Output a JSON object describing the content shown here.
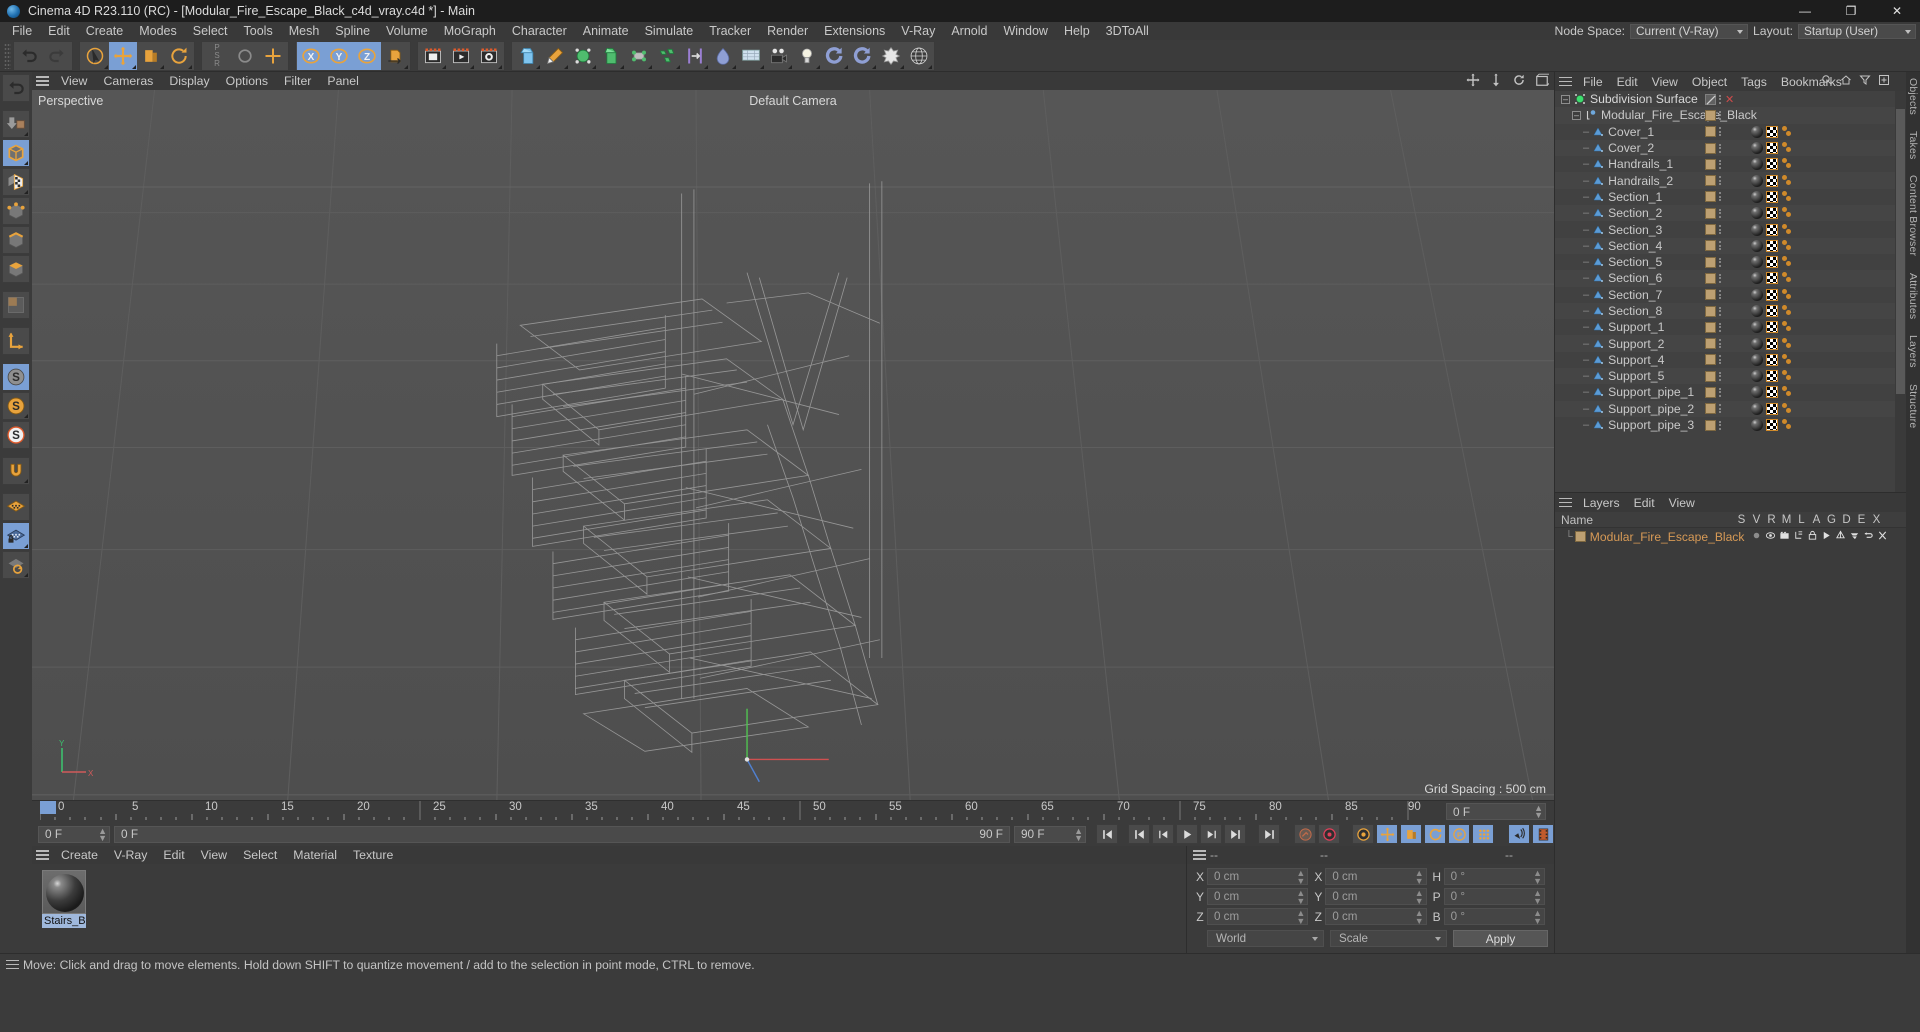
{
  "window": {
    "title": "Cinema 4D R23.110 (RC) - [Modular_Fire_Escape_Black_c4d_vray.c4d *] - Main",
    "app_icon": "c4d-logo-icon",
    "minimize": "—",
    "maximize": "❐",
    "close": "✕"
  },
  "menubar": {
    "items": [
      "File",
      "Edit",
      "Create",
      "Modes",
      "Select",
      "Tools",
      "Mesh",
      "Spline",
      "Volume",
      "MoGraph",
      "Character",
      "Animate",
      "Simulate",
      "Tracker",
      "Render",
      "Extensions",
      "V-Ray",
      "Arnold",
      "Window",
      "Help",
      "3DToAll"
    ],
    "node_space_label": "Node Space:",
    "node_space_value": "Current (V-Ray)",
    "layout_label": "Layout:",
    "layout_value": "Startup (User)"
  },
  "toolbar": {
    "groups": [
      {
        "name": "undo-redo",
        "buttons": [
          {
            "name": "undo-button",
            "icon": "undo-arrow-icon",
            "active": false
          },
          {
            "name": "redo-button",
            "icon": "redo-arrow-icon",
            "active": false
          }
        ]
      },
      {
        "name": "transform-tools",
        "buttons": [
          {
            "name": "select-tool",
            "icon": "cursor-arrow-icon",
            "active": false
          },
          {
            "name": "move-tool",
            "icon": "move-cross-icon",
            "active": true
          },
          {
            "name": "scale-tool",
            "icon": "scale-box-icon",
            "active": false
          },
          {
            "name": "rotate-tool",
            "icon": "rotate-circle-icon",
            "active": false
          }
        ]
      },
      {
        "name": "psr-group",
        "buttons": [
          {
            "name": "psr-label",
            "icon": "psr-text-icon",
            "active": false
          },
          {
            "name": "world-coordinates-toggle",
            "icon": "axis-cross-icon",
            "active": false
          }
        ]
      },
      {
        "name": "axis-locks",
        "buttons": [
          {
            "name": "lock-x-axis",
            "icon": "x-axis-icon",
            "active": true
          },
          {
            "name": "lock-y-axis",
            "icon": "y-axis-icon",
            "active": true
          },
          {
            "name": "lock-z-axis",
            "icon": "z-axis-icon",
            "active": true
          },
          {
            "name": "object-world-toggle",
            "icon": "world-cube-icon",
            "active": false
          }
        ]
      },
      {
        "name": "render-group",
        "buttons": [
          {
            "name": "render-view-button",
            "icon": "render-frame-icon",
            "active": false
          },
          {
            "name": "render-to-picture-viewer-button",
            "icon": "render-play-icon",
            "active": false
          },
          {
            "name": "render-settings-button",
            "icon": "render-gear-icon",
            "active": false
          }
        ]
      },
      {
        "name": "create-group",
        "buttons": [
          {
            "name": "add-primitive-cube-button",
            "icon": "cube-primitive-icon",
            "active": false
          },
          {
            "name": "add-spline-pen-button",
            "icon": "pen-spline-icon",
            "active": false
          },
          {
            "name": "add-generator-button",
            "icon": "generator-icon",
            "active": false
          },
          {
            "name": "add-nurbs-button",
            "icon": "nurbs-icon",
            "active": false
          },
          {
            "name": "add-deformer-button",
            "icon": "deformer-icon",
            "active": false
          },
          {
            "name": "add-mograph-button",
            "icon": "mograph-icon",
            "active": false
          },
          {
            "name": "add-field-button",
            "icon": "field-icon",
            "active": false
          },
          {
            "name": "add-dynamics-button",
            "icon": "dynamics-icon",
            "active": false
          },
          {
            "name": "add-floor-button",
            "icon": "floor-grid-icon",
            "active": false
          },
          {
            "name": "add-camera-button",
            "icon": "camera-icon",
            "active": false
          },
          {
            "name": "add-light-button",
            "icon": "light-bulb-icon",
            "active": false
          },
          {
            "name": "add-subdivision-button",
            "icon": "subdivision-icon",
            "active": false
          },
          {
            "name": "add-symmetry-button",
            "icon": "symmetry-icon",
            "active": false
          },
          {
            "name": "add-cloth-button",
            "icon": "cloth-icon",
            "active": false
          },
          {
            "name": "add-sky-button",
            "icon": "sky-globe-icon",
            "active": false
          }
        ]
      }
    ]
  },
  "left_rail": [
    {
      "name": "undo-rail-button",
      "icon": "undo-arrow-icon",
      "active": false
    },
    {
      "name": "make-editable-button",
      "icon": "make-editable-icon",
      "active": false
    },
    {
      "name": "model-mode-button",
      "icon": "model-cube-icon",
      "active": true
    },
    {
      "name": "texture-mode-button",
      "icon": "texture-checker-icon",
      "active": false
    },
    {
      "name": "point-mode-button",
      "icon": "point-mode-icon",
      "active": false
    },
    {
      "name": "edge-mode-button",
      "icon": "edge-mode-icon",
      "active": false
    },
    {
      "name": "polygon-mode-button",
      "icon": "polygon-mode-icon",
      "active": false
    },
    {
      "name": "uv-mode-button",
      "icon": "uv-mode-icon",
      "active": false
    },
    {
      "name": "axis-mode-button",
      "icon": "axis-L-icon",
      "active": false
    },
    {
      "name": "enable-axis-button",
      "icon": "s-grey-icon",
      "active": true
    },
    {
      "name": "enable-deformers-button",
      "icon": "s-orange-icon",
      "active": false
    },
    {
      "name": "viewport-solo-button",
      "icon": "s-white-icon",
      "active": false
    },
    {
      "name": "snap-magnet-button",
      "icon": "magnet-icon",
      "active": false
    },
    {
      "name": "workplane-button",
      "icon": "workplane-orange-icon",
      "active": false
    },
    {
      "name": "lock-workplane-button",
      "icon": "workplane-lock-icon",
      "active": true
    },
    {
      "name": "workplane-rotate-button",
      "icon": "workplane-rotate-icon",
      "active": false
    }
  ],
  "viewport": {
    "menu": [
      "View",
      "Cameras",
      "Display",
      "Options",
      "Filter",
      "Panel"
    ],
    "label": "Perspective",
    "camera": "Default Camera",
    "grid_spacing": "Grid Spacing : 500 cm",
    "axis": {
      "x": "X",
      "y": "Y"
    },
    "corner_icons": [
      {
        "name": "viewport-move-icon"
      },
      {
        "name": "viewport-scale-icon"
      },
      {
        "name": "viewport-rotate-icon"
      },
      {
        "name": "viewport-maximize-icon"
      }
    ]
  },
  "timeline": {
    "ticks": [
      "0",
      "5",
      "10",
      "15",
      "20",
      "25",
      "30",
      "35",
      "40",
      "45",
      "50",
      "55",
      "60",
      "65",
      "70",
      "75",
      "80",
      "85",
      "90"
    ],
    "current_frame": "0 F",
    "current_frame_right": "0 F",
    "preview_start": "0 F",
    "preview_end": "90 F",
    "max_frame": "90 F",
    "transport": [
      {
        "name": "goto-start-button",
        "icon": "skip-start-icon"
      },
      {
        "name": "previous-key-button",
        "icon": "prev-key-icon"
      },
      {
        "name": "step-back-button",
        "icon": "step-back-icon"
      },
      {
        "name": "play-button",
        "icon": "play-icon"
      },
      {
        "name": "step-forward-button",
        "icon": "step-forward-icon"
      },
      {
        "name": "next-key-button",
        "icon": "next-key-icon"
      },
      {
        "name": "goto-end-button",
        "icon": "skip-end-icon"
      },
      {
        "name": "record-active-objects-button",
        "icon": "record-key-icon"
      },
      {
        "name": "autokeying-button",
        "icon": "autokey-icon"
      },
      {
        "name": "keyframe-selection-button",
        "icon": "key-gear-icon"
      },
      {
        "name": "position-key-button",
        "icon": "position-key-icon",
        "active": true
      },
      {
        "name": "scale-key-button",
        "icon": "scale-key-icon",
        "active": true
      },
      {
        "name": "rotation-key-button",
        "icon": "rotation-key-icon",
        "active": true
      },
      {
        "name": "param-key-button",
        "icon": "param-key-icon",
        "active": true
      },
      {
        "name": "pla-key-button",
        "icon": "pla-key-icon",
        "active": true
      },
      {
        "name": "sound-button",
        "icon": "sound-icon",
        "active": true
      },
      {
        "name": "filmstrip-button",
        "icon": "filmstrip-icon",
        "active": true
      }
    ]
  },
  "material_manager": {
    "menu": [
      "Create",
      "V-Ray",
      "Edit",
      "View",
      "Select",
      "Material",
      "Texture"
    ],
    "materials": [
      {
        "name": "Stairs_Br",
        "icon": "material-sphere-icon",
        "selected": true
      }
    ]
  },
  "coordinates": {
    "headers": [
      "--",
      "--",
      "--"
    ],
    "rows": [
      {
        "labels": [
          "X",
          "X",
          "H"
        ],
        "values": [
          "0 cm",
          "0 cm",
          "0 °"
        ]
      },
      {
        "labels": [
          "Y",
          "Y",
          "P"
        ],
        "values": [
          "0 cm",
          "0 cm",
          "0 °"
        ]
      },
      {
        "labels": [
          "Z",
          "Z",
          "B"
        ],
        "values": [
          "0 cm",
          "0 cm",
          "0 °"
        ]
      }
    ],
    "space_select": "World",
    "mode_select": "Scale",
    "apply_label": "Apply"
  },
  "object_manager": {
    "menu": [
      "File",
      "Edit",
      "View",
      "Object",
      "Tags",
      "Bookmarks"
    ],
    "header_icons": [
      {
        "name": "search-icon"
      },
      {
        "name": "home-icon"
      },
      {
        "name": "filter-funnel-icon"
      },
      {
        "name": "add-layout-icon"
      }
    ],
    "items": [
      {
        "label": "Subdivision Surface",
        "depth": 0,
        "icon": "subdivision-surface-icon",
        "swatch": false,
        "enable_toggle": true,
        "has_x": true,
        "tags": []
      },
      {
        "label": "Modular_Fire_Escape_Black",
        "depth": 1,
        "icon": "null-object-icon",
        "swatch": true,
        "tags": []
      },
      {
        "label": "Cover_1",
        "depth": 2,
        "icon": "polygon-object-icon",
        "swatch": true,
        "tags": [
          "material",
          "uv",
          "selection"
        ]
      },
      {
        "label": "Cover_2",
        "depth": 2,
        "icon": "polygon-object-icon",
        "swatch": true,
        "tags": [
          "material",
          "uv",
          "selection"
        ]
      },
      {
        "label": "Handrails_1",
        "depth": 2,
        "icon": "polygon-object-icon",
        "swatch": true,
        "tags": [
          "material",
          "uv",
          "selection"
        ]
      },
      {
        "label": "Handrails_2",
        "depth": 2,
        "icon": "polygon-object-icon",
        "swatch": true,
        "tags": [
          "material",
          "uv",
          "selection"
        ]
      },
      {
        "label": "Section_1",
        "depth": 2,
        "icon": "polygon-object-icon",
        "swatch": true,
        "tags": [
          "material",
          "uv",
          "selection"
        ]
      },
      {
        "label": "Section_2",
        "depth": 2,
        "icon": "polygon-object-icon",
        "swatch": true,
        "tags": [
          "material",
          "uv",
          "selection"
        ]
      },
      {
        "label": "Section_3",
        "depth": 2,
        "icon": "polygon-object-icon",
        "swatch": true,
        "tags": [
          "material",
          "uv",
          "selection"
        ]
      },
      {
        "label": "Section_4",
        "depth": 2,
        "icon": "polygon-object-icon",
        "swatch": true,
        "tags": [
          "material",
          "uv",
          "selection"
        ]
      },
      {
        "label": "Section_5",
        "depth": 2,
        "icon": "polygon-object-icon",
        "swatch": true,
        "tags": [
          "material",
          "uv",
          "selection"
        ]
      },
      {
        "label": "Section_6",
        "depth": 2,
        "icon": "polygon-object-icon",
        "swatch": true,
        "tags": [
          "material",
          "uv",
          "selection"
        ]
      },
      {
        "label": "Section_7",
        "depth": 2,
        "icon": "polygon-object-icon",
        "swatch": true,
        "tags": [
          "material",
          "uv",
          "selection"
        ]
      },
      {
        "label": "Section_8",
        "depth": 2,
        "icon": "polygon-object-icon",
        "swatch": true,
        "tags": [
          "material",
          "uv",
          "selection"
        ]
      },
      {
        "label": "Support_1",
        "depth": 2,
        "icon": "polygon-object-icon",
        "swatch": true,
        "tags": [
          "material",
          "uv",
          "selection"
        ]
      },
      {
        "label": "Support_2",
        "depth": 2,
        "icon": "polygon-object-icon",
        "swatch": true,
        "tags": [
          "material",
          "uv",
          "selection"
        ]
      },
      {
        "label": "Support_4",
        "depth": 2,
        "icon": "polygon-object-icon",
        "swatch": true,
        "tags": [
          "material",
          "uv",
          "selection"
        ]
      },
      {
        "label": "Support_5",
        "depth": 2,
        "icon": "polygon-object-icon",
        "swatch": true,
        "tags": [
          "material",
          "uv",
          "selection"
        ]
      },
      {
        "label": "Support_pipe_1",
        "depth": 2,
        "icon": "polygon-object-icon",
        "swatch": true,
        "tags": [
          "material",
          "uv",
          "selection"
        ]
      },
      {
        "label": "Support_pipe_2",
        "depth": 2,
        "icon": "polygon-object-icon",
        "swatch": true,
        "tags": [
          "material",
          "uv",
          "selection"
        ]
      },
      {
        "label": "Support_pipe_3",
        "depth": 2,
        "icon": "polygon-object-icon",
        "swatch": true,
        "tags": [
          "material",
          "uv",
          "selection"
        ]
      }
    ]
  },
  "layers_manager": {
    "menu": [
      "Layers",
      "Edit",
      "View"
    ],
    "name_header": "Name",
    "columns": [
      "S",
      "V",
      "R",
      "M",
      "L",
      "A",
      "G",
      "D",
      "E",
      "X"
    ],
    "rows": [
      {
        "label": "Modular_Fire_Escape_Black",
        "swatch_color": "#bda072",
        "icons": [
          "solo-dot-icon",
          "visible-eye-icon",
          "render-camera-icon",
          "manager-tree-icon",
          "lock-icon",
          "animation-play-icon",
          "generator-icon",
          "deformer-icon",
          "expression-icon",
          "xref-icon"
        ]
      }
    ]
  },
  "vertical_tabs_right": [
    "Objects",
    "Takes",
    "Content Browser"
  ],
  "vertical_tabs_far_right": [
    "Attributes",
    "Layers",
    "Structure"
  ],
  "statusbar": {
    "text": "Move: Click and drag to move elements. Hold down SHIFT to quantize movement / add to the selection in point mode, CTRL to remove."
  },
  "colors": {
    "accent_orange": "#e8a33d",
    "accent_blue": "#7a9fd4",
    "layer_swatch": "#bda072",
    "layer_text": "#d79a56",
    "panel_bg": "#3b3b3b",
    "viewport_bg": "#525252"
  }
}
